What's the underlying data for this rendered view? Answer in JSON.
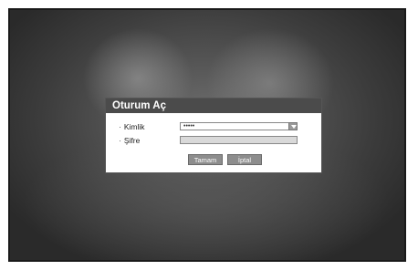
{
  "dialog": {
    "title": "Oturum Aç",
    "id_label": "Kimlik",
    "id_value": "•••••",
    "password_label": "Şifre",
    "password_value": "",
    "ok_label": "Tamam",
    "cancel_label": "İptal",
    "bullet": "·"
  },
  "colors": {
    "header_bg": "#4b4b4b",
    "button_bg": "#8d8d8d",
    "password_bg": "#d9d9d9"
  }
}
